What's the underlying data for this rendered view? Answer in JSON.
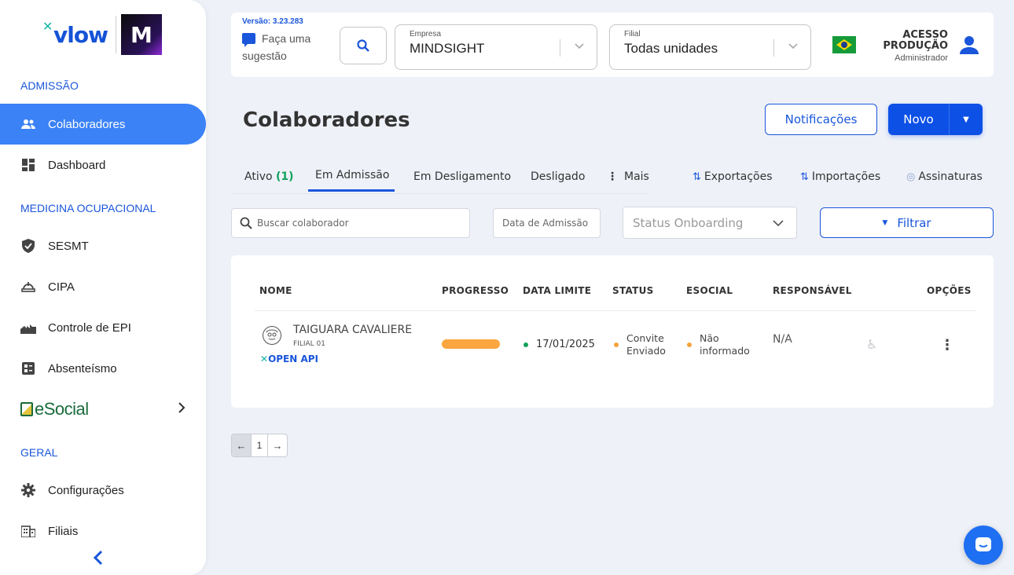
{
  "brand": {
    "logo_text": "vlow",
    "logo_mark": "M"
  },
  "sidebar": {
    "sections": {
      "admissao": "ADMISSÃO",
      "medicina": "MEDICINA OCUPACIONAL",
      "geral": "GERAL"
    },
    "items": [
      {
        "label": "Colaboradores",
        "icon": "people-icon",
        "active": true
      },
      {
        "label": "Dashboard",
        "icon": "dashboard-icon"
      },
      {
        "label": "SESMT",
        "icon": "shield-icon"
      },
      {
        "label": "CIPA",
        "icon": "hard-hat-icon"
      },
      {
        "label": "Controle de EPI",
        "icon": "factory-icon"
      },
      {
        "label": "Absenteísmo",
        "icon": "report-icon"
      },
      {
        "label": "Configurações",
        "icon": "gear-icon"
      },
      {
        "label": "Filiais",
        "icon": "building-icon"
      }
    ],
    "esocial_label": "eSocial"
  },
  "topbar": {
    "version": "Versão: 3.23.283",
    "suggestion": "Faça uma sugestão",
    "empresa_label": "Empresa",
    "empresa_value": "MINDSIGHT",
    "filial_label": "Filial",
    "filial_value": "Todas unidades",
    "access_line1": "ACESSO",
    "access_line2": "PRODUÇÃO",
    "access_role": "Administrador"
  },
  "page": {
    "title": "Colaboradores",
    "notif_button": "Notificações",
    "new_button": "Novo"
  },
  "tabs": {
    "ativo": "Ativo",
    "ativo_count": "(1)",
    "em_admissao": "Em Admissão",
    "em_desligamento": "Em Desligamento",
    "desligado": "Desligado",
    "mais": "Mais"
  },
  "actions": {
    "exportacoes": "Exportações",
    "importacoes": "Importações",
    "assinaturas": "Assinaturas"
  },
  "filters": {
    "search_placeholder": "Buscar colaborador",
    "date_placeholder": "Data de Admissão",
    "status_placeholder": "Status Onboarding",
    "filter_button": "Filtrar"
  },
  "table": {
    "headers": {
      "nome": "NOME",
      "progresso": "PROGRESSO",
      "data_limite": "DATA LIMITE",
      "status": "STATUS",
      "esocial": "ESOCIAL",
      "responsavel": "RESPONSÁVEL",
      "opcoes": "OPÇÕES"
    },
    "rows": [
      {
        "name": "TAIGUARA CAVALIERE",
        "filial": "FILIAL 01",
        "source": "OPEN API",
        "progress": 1.0,
        "deadline": "17/01/2025",
        "status_line1": "Convite",
        "status_line2": "Enviado",
        "esocial_line1": "Não",
        "esocial_line2": "informado",
        "responsavel": "N/A"
      }
    ]
  },
  "pagination": {
    "current_page": "1"
  },
  "colors": {
    "accent": "#1a56db",
    "active_nav": "#3b82f6",
    "progress": "#fba63f",
    "deadline_dot": "#12a15b",
    "status_dot": "#f5a33a",
    "count_green": "#12a15b"
  }
}
